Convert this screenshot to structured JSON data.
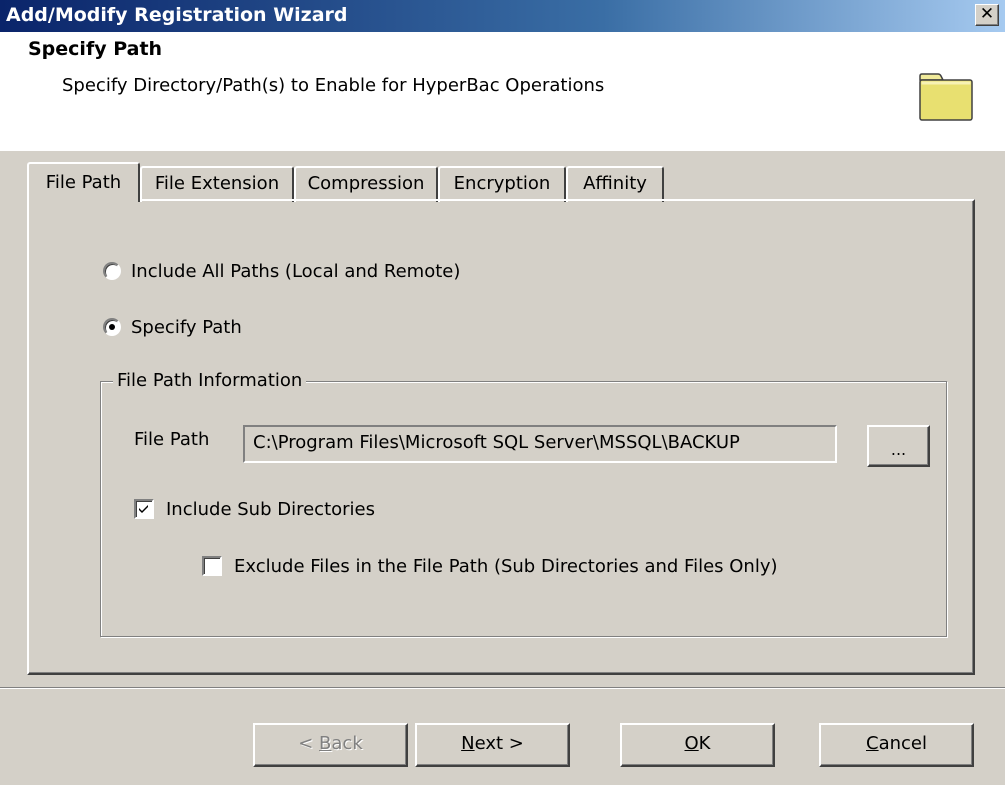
{
  "window": {
    "title": "Add/Modify Registration Wizard",
    "close_glyph": "✕"
  },
  "header": {
    "title": "Specify Path",
    "subtitle": "Specify Directory/Path(s) to Enable for HyperBac Operations",
    "icon": "folder-icon"
  },
  "tabs": [
    {
      "label": "File Path",
      "active": true
    },
    {
      "label": "File Extension",
      "active": false
    },
    {
      "label": "Compression",
      "active": false
    },
    {
      "label": "Encryption",
      "active": false
    },
    {
      "label": "Affinity",
      "active": false
    }
  ],
  "options": {
    "include_all": {
      "label": "Include All Paths (Local and Remote)",
      "checked": false
    },
    "specify_path": {
      "label": "Specify Path",
      "checked": true
    }
  },
  "group": {
    "legend": "File Path Information",
    "file_path_label": "File Path",
    "file_path_value": "C:\\Program Files\\Microsoft SQL Server\\MSSQL\\BACKUP",
    "browse_label": "...",
    "include_sub": {
      "label": "Include Sub Directories",
      "checked": true
    },
    "exclude_files": {
      "label": "Exclude Files in the File Path (Sub Directories and Files Only)",
      "checked": false
    }
  },
  "buttons": {
    "back": {
      "pre": "< ",
      "accel": "B",
      "rest": "ack",
      "enabled": false
    },
    "next": {
      "pre": "",
      "accel": "N",
      "rest": "ext >",
      "enabled": true
    },
    "ok": {
      "pre": "",
      "accel": "O",
      "rest": "K",
      "enabled": true
    },
    "cancel": {
      "pre": "",
      "accel": "C",
      "rest": "ancel",
      "enabled": true
    }
  },
  "colors": {
    "title_gradient_start": "#0a246a",
    "title_gradient_end": "#a6caf0",
    "face": "#d4d0c8",
    "folder": "#e8e070"
  }
}
